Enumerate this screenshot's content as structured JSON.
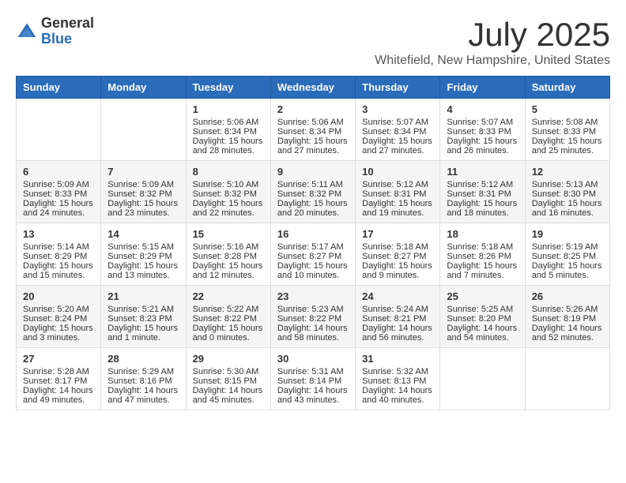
{
  "logo": {
    "general": "General",
    "blue": "Blue"
  },
  "title": {
    "month": "July 2025",
    "location": "Whitefield, New Hampshire, United States"
  },
  "days_of_week": [
    "Sunday",
    "Monday",
    "Tuesday",
    "Wednesday",
    "Thursday",
    "Friday",
    "Saturday"
  ],
  "weeks": [
    [
      {
        "day": "",
        "info": ""
      },
      {
        "day": "",
        "info": ""
      },
      {
        "day": "1",
        "info": "Sunrise: 5:06 AM\nSunset: 8:34 PM\nDaylight: 15 hours\nand 28 minutes."
      },
      {
        "day": "2",
        "info": "Sunrise: 5:06 AM\nSunset: 8:34 PM\nDaylight: 15 hours\nand 27 minutes."
      },
      {
        "day": "3",
        "info": "Sunrise: 5:07 AM\nSunset: 8:34 PM\nDaylight: 15 hours\nand 27 minutes."
      },
      {
        "day": "4",
        "info": "Sunrise: 5:07 AM\nSunset: 8:33 PM\nDaylight: 15 hours\nand 26 minutes."
      },
      {
        "day": "5",
        "info": "Sunrise: 5:08 AM\nSunset: 8:33 PM\nDaylight: 15 hours\nand 25 minutes."
      }
    ],
    [
      {
        "day": "6",
        "info": "Sunrise: 5:09 AM\nSunset: 8:33 PM\nDaylight: 15 hours\nand 24 minutes."
      },
      {
        "day": "7",
        "info": "Sunrise: 5:09 AM\nSunset: 8:32 PM\nDaylight: 15 hours\nand 23 minutes."
      },
      {
        "day": "8",
        "info": "Sunrise: 5:10 AM\nSunset: 8:32 PM\nDaylight: 15 hours\nand 22 minutes."
      },
      {
        "day": "9",
        "info": "Sunrise: 5:11 AM\nSunset: 8:32 PM\nDaylight: 15 hours\nand 20 minutes."
      },
      {
        "day": "10",
        "info": "Sunrise: 5:12 AM\nSunset: 8:31 PM\nDaylight: 15 hours\nand 19 minutes."
      },
      {
        "day": "11",
        "info": "Sunrise: 5:12 AM\nSunset: 8:31 PM\nDaylight: 15 hours\nand 18 minutes."
      },
      {
        "day": "12",
        "info": "Sunrise: 5:13 AM\nSunset: 8:30 PM\nDaylight: 15 hours\nand 16 minutes."
      }
    ],
    [
      {
        "day": "13",
        "info": "Sunrise: 5:14 AM\nSunset: 8:29 PM\nDaylight: 15 hours\nand 15 minutes."
      },
      {
        "day": "14",
        "info": "Sunrise: 5:15 AM\nSunset: 8:29 PM\nDaylight: 15 hours\nand 13 minutes."
      },
      {
        "day": "15",
        "info": "Sunrise: 5:16 AM\nSunset: 8:28 PM\nDaylight: 15 hours\nand 12 minutes."
      },
      {
        "day": "16",
        "info": "Sunrise: 5:17 AM\nSunset: 8:27 PM\nDaylight: 15 hours\nand 10 minutes."
      },
      {
        "day": "17",
        "info": "Sunrise: 5:18 AM\nSunset: 8:27 PM\nDaylight: 15 hours\nand 9 minutes."
      },
      {
        "day": "18",
        "info": "Sunrise: 5:18 AM\nSunset: 8:26 PM\nDaylight: 15 hours\nand 7 minutes."
      },
      {
        "day": "19",
        "info": "Sunrise: 5:19 AM\nSunset: 8:25 PM\nDaylight: 15 hours\nand 5 minutes."
      }
    ],
    [
      {
        "day": "20",
        "info": "Sunrise: 5:20 AM\nSunset: 8:24 PM\nDaylight: 15 hours\nand 3 minutes."
      },
      {
        "day": "21",
        "info": "Sunrise: 5:21 AM\nSunset: 8:23 PM\nDaylight: 15 hours\nand 1 minute."
      },
      {
        "day": "22",
        "info": "Sunrise: 5:22 AM\nSunset: 8:22 PM\nDaylight: 15 hours\nand 0 minutes."
      },
      {
        "day": "23",
        "info": "Sunrise: 5:23 AM\nSunset: 8:22 PM\nDaylight: 14 hours\nand 58 minutes."
      },
      {
        "day": "24",
        "info": "Sunrise: 5:24 AM\nSunset: 8:21 PM\nDaylight: 14 hours\nand 56 minutes."
      },
      {
        "day": "25",
        "info": "Sunrise: 5:25 AM\nSunset: 8:20 PM\nDaylight: 14 hours\nand 54 minutes."
      },
      {
        "day": "26",
        "info": "Sunrise: 5:26 AM\nSunset: 8:19 PM\nDaylight: 14 hours\nand 52 minutes."
      }
    ],
    [
      {
        "day": "27",
        "info": "Sunrise: 5:28 AM\nSunset: 8:17 PM\nDaylight: 14 hours\nand 49 minutes."
      },
      {
        "day": "28",
        "info": "Sunrise: 5:29 AM\nSunset: 8:16 PM\nDaylight: 14 hours\nand 47 minutes."
      },
      {
        "day": "29",
        "info": "Sunrise: 5:30 AM\nSunset: 8:15 PM\nDaylight: 14 hours\nand 45 minutes."
      },
      {
        "day": "30",
        "info": "Sunrise: 5:31 AM\nSunset: 8:14 PM\nDaylight: 14 hours\nand 43 minutes."
      },
      {
        "day": "31",
        "info": "Sunrise: 5:32 AM\nSunset: 8:13 PM\nDaylight: 14 hours\nand 40 minutes."
      },
      {
        "day": "",
        "info": ""
      },
      {
        "day": "",
        "info": ""
      }
    ]
  ]
}
